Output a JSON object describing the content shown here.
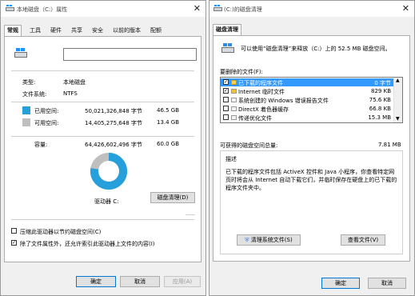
{
  "props": {
    "title": "本地磁盘（C:）属性",
    "tabs": [
      "常规",
      "工具",
      "硬件",
      "共享",
      "安全",
      "以前的版本",
      "配额"
    ],
    "label_field_value": "",
    "type_label": "类型:",
    "type_value": "本地磁盘",
    "fs_label": "文件系统:",
    "fs_value": "NTFS",
    "used_label": "已用空间:",
    "used_bytes": "50,021,326,848 字节",
    "used_gb": "46.5 GB",
    "free_label": "可用空间:",
    "free_bytes": "14,405,275,648 字节",
    "free_gb": "13.4 GB",
    "capacity_label": "容量:",
    "capacity_bytes": "64,426,602,496 字节",
    "capacity_gb": "60.0 GB",
    "drive_label": "驱动器 C:",
    "cleanup_button": "磁盘清理(D)",
    "compress_label": "压缩此驱动器以节约磁盘空间(C)",
    "index_label": "除了文件属性外，还允许索引此驱动器上文件的内容(I)",
    "ok": "确定",
    "cancel": "取消",
    "apply": "应用(A)",
    "used_fraction": 0.776,
    "colors": {
      "used": "#26a0da",
      "free": "#bfbfbf"
    }
  },
  "cleanup": {
    "title": "(C:)的磁盘清理",
    "tab": "磁盘清理",
    "intro": "可以使用“磁盘清理”来释放（C:）上的 52.5 MB 磁盘空间。",
    "files_label": "要删除的文件(F):",
    "items": [
      {
        "label": "已下载的程序文件",
        "size": "0 字节",
        "checked": true,
        "selected": true
      },
      {
        "label": "Internet 临时文件",
        "size": "829 KB",
        "checked": true,
        "selected": false
      },
      {
        "label": "系统创建的 Windows 错误报告文件",
        "size": "75.6 KB",
        "checked": false,
        "selected": false
      },
      {
        "label": "DirectX 着色器缓存",
        "size": "66.8 KB",
        "checked": false,
        "selected": false
      },
      {
        "label": "传递优化文件",
        "size": "15.3 MB",
        "checked": false,
        "selected": false
      }
    ],
    "gain_label": "可获得的磁盘空间总量:",
    "gain_value": "7.81 MB",
    "desc_label": "描述",
    "description": "已下载的程序文件包括 ActiveX 控件和 Java 小程序，你查看特定网页时将会从 Internet 自动下载它们，并临时保存在硬盘上的已下载的程序文件夹中。",
    "clean_system_button": "清理系统文件(S)",
    "view_files_button": "查看文件(V)",
    "ok": "确定",
    "cancel": "取消"
  }
}
